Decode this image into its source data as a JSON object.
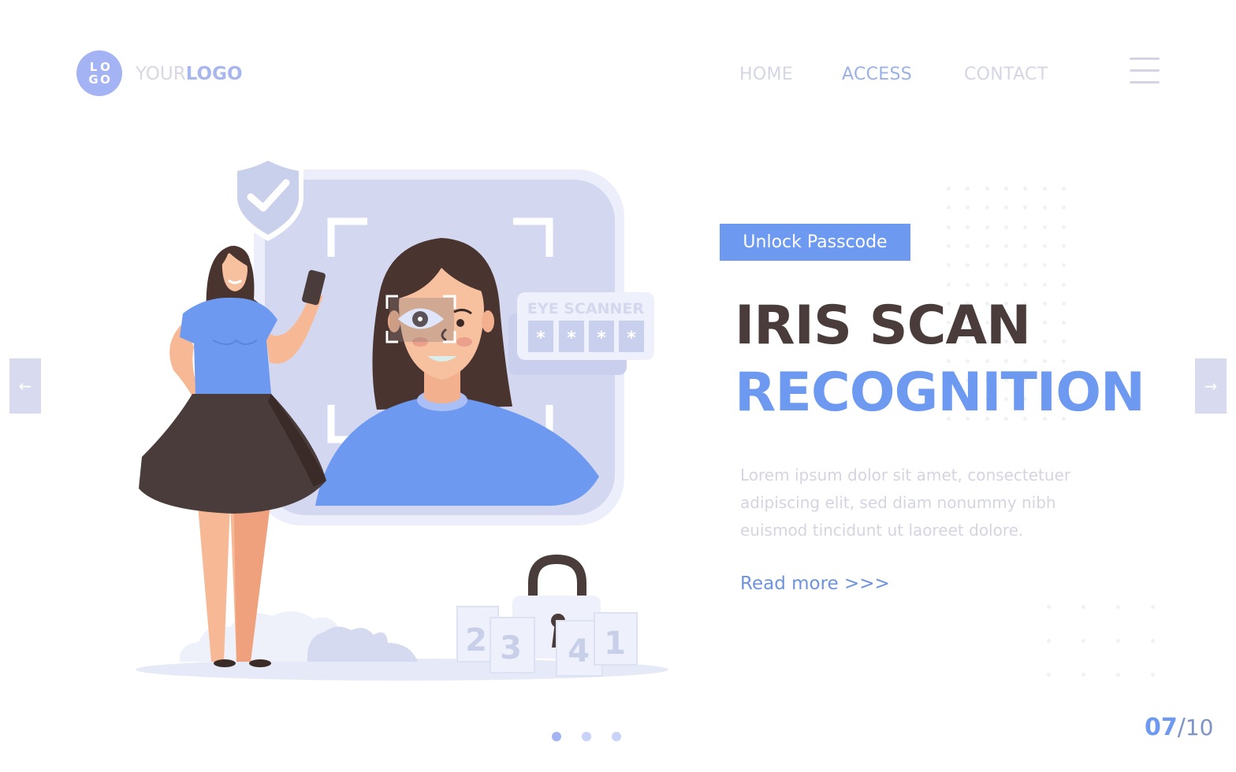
{
  "logo": {
    "badge_letters": [
      "L",
      "O",
      "G",
      "O"
    ],
    "text_light": "YOUR",
    "text_bold": "LOGO"
  },
  "nav": {
    "items": [
      {
        "label": "HOME",
        "active": false
      },
      {
        "label": "ACCESS",
        "active": true
      },
      {
        "label": "CONTACT",
        "active": false
      }
    ],
    "menu_icon": "hamburger-icon"
  },
  "carousel": {
    "prev_icon": "←",
    "next_icon": "→",
    "dots": 3,
    "active_dot": 0
  },
  "hero": {
    "tag": "Unlock Passcode",
    "title_line1": "IRIS SCAN",
    "title_line2": "RECOGNITION",
    "description": "Lorem ipsum dolor sit amet, consectetuer adipiscing elit, sed diam nonummy nibh euismod tincidunt ut laoreet dolore.",
    "read_more": "Read more >>>"
  },
  "illustration": {
    "scanner_label": "EYE SCANNER",
    "pin_mask": [
      "*",
      "*",
      "*",
      "*"
    ],
    "code_cards": [
      "2",
      "3",
      "4",
      "1"
    ]
  },
  "slide_counter": {
    "current": "07",
    "separator": "/",
    "total": "10"
  },
  "colors": {
    "accent": "#6d9af0",
    "dark": "#4a3c3a",
    "muted": "#d4d4e2",
    "panel": "#d3d8f0"
  }
}
